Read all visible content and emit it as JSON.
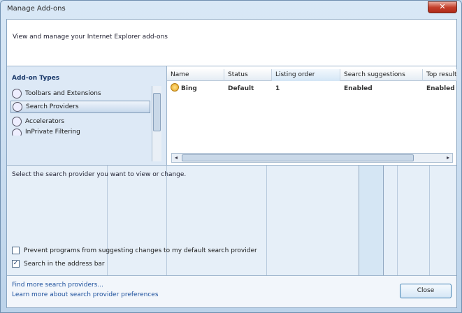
{
  "window": {
    "title": "Manage Add-ons",
    "close_glyph": "✕"
  },
  "banner": {
    "text": "View and manage your Internet Explorer add-ons"
  },
  "addon_types": {
    "title": "Add-on Types",
    "items": [
      {
        "label": "Toolbars and Extensions",
        "icon": "gear-icon",
        "selected": false
      },
      {
        "label": "Search Providers",
        "icon": "search-icon",
        "selected": true
      },
      {
        "label": "Accelerators",
        "icon": "accelerator-icon",
        "selected": false
      },
      {
        "label": "InPrivate Filtering",
        "icon": "inprivate-icon",
        "selected": false
      }
    ]
  },
  "grid": {
    "columns": [
      "Name",
      "Status",
      "Listing order",
      "Search suggestions",
      "Top result"
    ],
    "sorted_column": "Listing order",
    "rows": [
      {
        "name": "Bing",
        "status": "Default",
        "order": "1",
        "suggestions": "Enabled",
        "top_result": "Enabled"
      }
    ]
  },
  "details": {
    "hint": "Select the search provider you want to view or change."
  },
  "options": [
    {
      "label": "Prevent programs from suggesting changes to my default search provider",
      "checked": false
    },
    {
      "label": "Search in the address bar",
      "checked": true
    }
  ],
  "footer": {
    "link1": "Find more search providers...",
    "link2": "Learn more about search provider preferences",
    "close_label": "Close"
  }
}
